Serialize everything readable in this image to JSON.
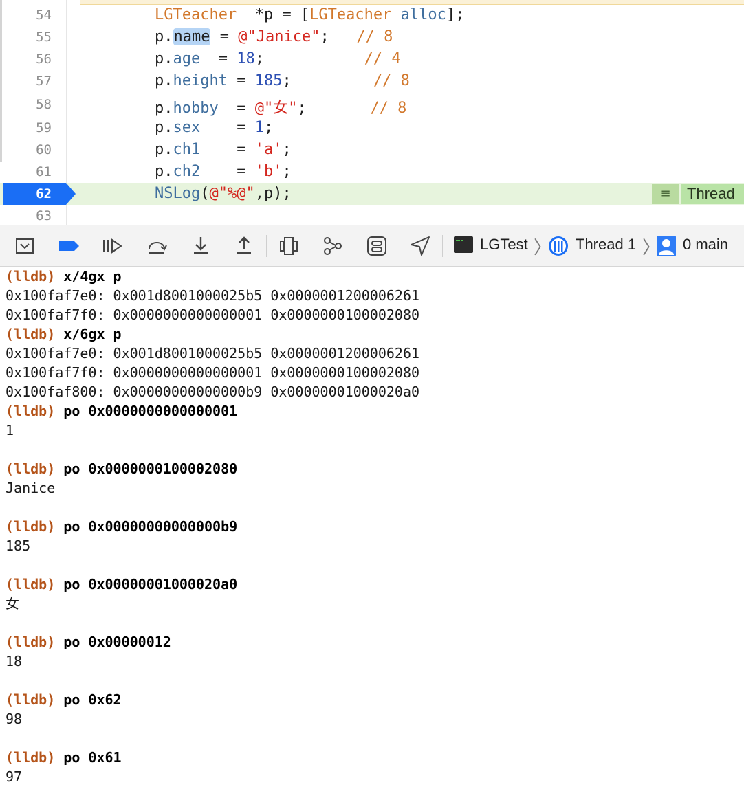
{
  "editor": {
    "lines": [
      {
        "num": "54",
        "tokens": [
          [
            "cls",
            "LGTeacher"
          ],
          [
            "plain",
            "  *p = ["
          ],
          [
            "cls",
            "LGTeacher"
          ],
          [
            "plain",
            " "
          ],
          [
            "fn",
            "alloc"
          ],
          [
            "plain",
            "];"
          ]
        ]
      },
      {
        "num": "55",
        "tokens": [
          [
            "plain",
            "p."
          ],
          [
            "sel",
            "name"
          ],
          [
            "plain",
            " = "
          ],
          [
            "str",
            "@\"Janice\""
          ],
          [
            "plain",
            ";   "
          ],
          [
            "cmt",
            "// 8"
          ]
        ]
      },
      {
        "num": "56",
        "tokens": [
          [
            "plain",
            "p."
          ],
          [
            "prop",
            "age"
          ],
          [
            "plain",
            "  = "
          ],
          [
            "num",
            "18"
          ],
          [
            "plain",
            ";           "
          ],
          [
            "cmt",
            "// 4"
          ]
        ]
      },
      {
        "num": "57",
        "tokens": [
          [
            "plain",
            "p."
          ],
          [
            "prop",
            "height"
          ],
          [
            "plain",
            " = "
          ],
          [
            "num",
            "185"
          ],
          [
            "plain",
            ";         "
          ],
          [
            "cmt",
            "// 8"
          ]
        ]
      },
      {
        "num": "58",
        "tokens": [
          [
            "plain",
            "p."
          ],
          [
            "prop",
            "hobby"
          ],
          [
            "plain",
            "  = "
          ],
          [
            "str",
            "@\"女\""
          ],
          [
            "plain",
            ";       "
          ],
          [
            "cmt",
            "// 8"
          ]
        ]
      },
      {
        "num": "59",
        "tokens": [
          [
            "plain",
            "p."
          ],
          [
            "prop",
            "sex"
          ],
          [
            "plain",
            "    = "
          ],
          [
            "num",
            "1"
          ],
          [
            "plain",
            ";"
          ]
        ]
      },
      {
        "num": "60",
        "tokens": [
          [
            "plain",
            "p."
          ],
          [
            "prop",
            "ch1"
          ],
          [
            "plain",
            "    = "
          ],
          [
            "str",
            "'a'"
          ],
          [
            "plain",
            ";"
          ]
        ]
      },
      {
        "num": "61",
        "tokens": [
          [
            "plain",
            "p."
          ],
          [
            "prop",
            "ch2"
          ],
          [
            "plain",
            "    = "
          ],
          [
            "str",
            "'b'"
          ],
          [
            "plain",
            ";"
          ]
        ]
      },
      {
        "num": "62",
        "current": true,
        "tokens": [
          [
            "fn",
            "NSLog"
          ],
          [
            "plain",
            "("
          ],
          [
            "str",
            "@\"%@\""
          ],
          [
            "plain",
            ",p);"
          ]
        ]
      },
      {
        "num": "63",
        "tokens": []
      }
    ],
    "thread_badge": {
      "icon": "≡",
      "label": "Thread"
    }
  },
  "toolbar": {
    "target": "LGTest",
    "thread": "Thread 1",
    "frame": "0 main"
  },
  "console": {
    "lines": [
      {
        "p": "(lldb)",
        "c": "x/4gx p"
      },
      {
        "t": "0x100faf7e0: 0x001d8001000025b5 0x0000001200006261"
      },
      {
        "t": "0x100faf7f0: 0x0000000000000001 0x0000000100002080"
      },
      {
        "p": "(lldb)",
        "c": "x/6gx p"
      },
      {
        "t": "0x100faf7e0: 0x001d8001000025b5 0x0000001200006261"
      },
      {
        "t": "0x100faf7f0: 0x0000000000000001 0x0000000100002080"
      },
      {
        "t": "0x100faf800: 0x00000000000000b9 0x00000001000020a0"
      },
      {
        "p": "(lldb)",
        "c": "po 0x0000000000000001"
      },
      {
        "t": "1"
      },
      {
        "t": ""
      },
      {
        "p": "(lldb)",
        "c": "po 0x0000000100002080"
      },
      {
        "t": "Janice"
      },
      {
        "t": ""
      },
      {
        "p": "(lldb)",
        "c": "po 0x00000000000000b9"
      },
      {
        "t": "185"
      },
      {
        "t": ""
      },
      {
        "p": "(lldb)",
        "c": "po 0x00000001000020a0"
      },
      {
        "t": "女"
      },
      {
        "t": ""
      },
      {
        "p": "(lldb)",
        "c": "po 0x00000012"
      },
      {
        "t": "18"
      },
      {
        "t": ""
      },
      {
        "p": "(lldb)",
        "c": "po 0x62"
      },
      {
        "t": "98"
      },
      {
        "t": ""
      },
      {
        "p": "(lldb)",
        "c": "po 0x61"
      },
      {
        "t": "97"
      }
    ]
  }
}
